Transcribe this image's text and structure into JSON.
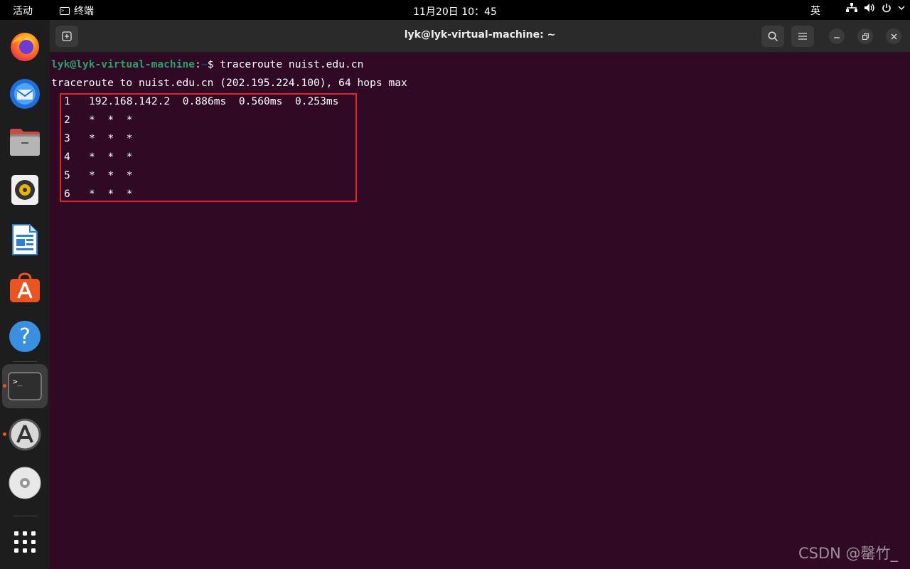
{
  "topbar": {
    "activities": "活动",
    "app_name": "终端",
    "clock": "11月20日  10：45",
    "input_method": "英"
  },
  "window": {
    "title": "lyk@lyk-virtual-machine: ~"
  },
  "terminal": {
    "prompt_user": "lyk@lyk-virtual-machine",
    "prompt_sep": ":",
    "prompt_path": "~",
    "prompt_symbol": "$",
    "command": " traceroute nuist.edu.cn",
    "header": "traceroute to nuist.edu.cn (202.195.224.100), 64 hops max",
    "hops": [
      {
        "n": "1",
        "text": "192.168.142.2  0.886ms  0.560ms  0.253ms"
      },
      {
        "n": "2",
        "text": "*  *  *"
      },
      {
        "n": "3",
        "text": "*  *  *"
      },
      {
        "n": "4",
        "text": "*  *  *"
      },
      {
        "n": "5",
        "text": "*  *  *"
      },
      {
        "n": "6",
        "text": "*  *  *"
      }
    ]
  },
  "dock": {
    "items": [
      "firefox-icon",
      "thunderbird-icon",
      "files-icon",
      "rhythmbox-icon",
      "libreoffice-writer-icon",
      "app-center-icon",
      "help-icon",
      "terminal-icon",
      "software-updater-icon",
      "dvd-icon",
      "show-apps-icon"
    ]
  },
  "watermark": "CSDN @罄竹_",
  "colors": {
    "terminal_bg": "#300a24",
    "prompt_user": "#26a269",
    "prompt_path": "#12488b",
    "highlight_box": "#e0262c",
    "accent": "#e95420"
  }
}
